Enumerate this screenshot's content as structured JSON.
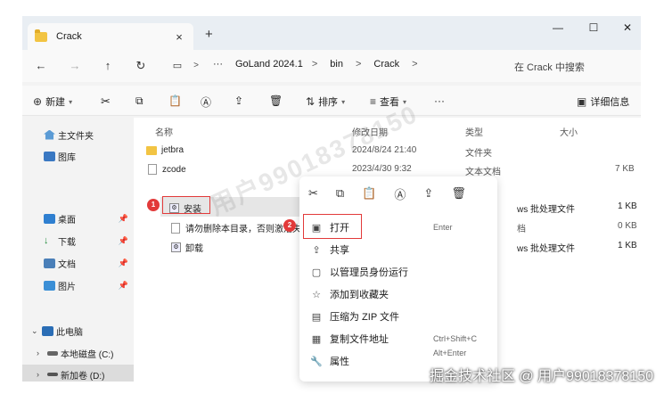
{
  "tab": {
    "title": "Crack",
    "close": "×",
    "new": "+"
  },
  "window": {
    "minimize": "—",
    "maximize": "☐",
    "close": "✕"
  },
  "nav": {
    "back": "←",
    "forward": "→",
    "up": "↑",
    "refresh": "↻",
    "crumbs": [
      "···",
      "GoLand 2024.1",
      "bin",
      "Crack"
    ],
    "sep": ">",
    "search_placeholder": "在 Crack 中搜索"
  },
  "toolbar": {
    "new_label": "新建",
    "sort_label": "排序",
    "view_label": "查看",
    "more": "···",
    "details_label": "详细信息"
  },
  "sidebar": {
    "items": [
      {
        "label": "主文件夹"
      },
      {
        "label": "图库"
      },
      {
        "label": "桌面"
      },
      {
        "label": "下载"
      },
      {
        "label": "文档"
      },
      {
        "label": "图片"
      },
      {
        "label": "此电脑"
      },
      {
        "label": "本地磁盘 (C:)"
      },
      {
        "label": "新加卷 (D:)"
      }
    ]
  },
  "columns": {
    "name": "名称",
    "date": "修改日期",
    "type": "类型",
    "size": "大小"
  },
  "files": [
    {
      "name": "jetbra",
      "date": "2024/8/24 21:40",
      "type": "文件夹",
      "size": ""
    },
    {
      "name": "zcode",
      "date": "2023/4/30 9:32",
      "type": "文本文档",
      "size": "7 KB"
    },
    {
      "name": "安装",
      "date": "",
      "type": "ws 批处理文件",
      "size": "1 KB"
    },
    {
      "name": "请勿删除本目录，否则激活失效",
      "date": "",
      "type": "档",
      "size": "0 KB"
    },
    {
      "name": "卸载",
      "date": "",
      "type": "ws 批处理文件",
      "size": "1 KB"
    }
  ],
  "badges": {
    "one": "1",
    "two": "2"
  },
  "menu": {
    "items": [
      {
        "label": "打开",
        "shortcut": "Enter"
      },
      {
        "label": "共享",
        "shortcut": ""
      },
      {
        "label": "以管理员身份运行",
        "shortcut": ""
      },
      {
        "label": "添加到收藏夹",
        "shortcut": ""
      },
      {
        "label": "压缩为 ZIP 文件",
        "shortcut": ""
      },
      {
        "label": "复制文件地址",
        "shortcut": "Ctrl+Shift+C"
      },
      {
        "label": "属性",
        "shortcut": "Alt+Enter"
      }
    ]
  },
  "watermark": "用户99018378150",
  "credit": "掘金技术社区 @ 用户99018378150"
}
